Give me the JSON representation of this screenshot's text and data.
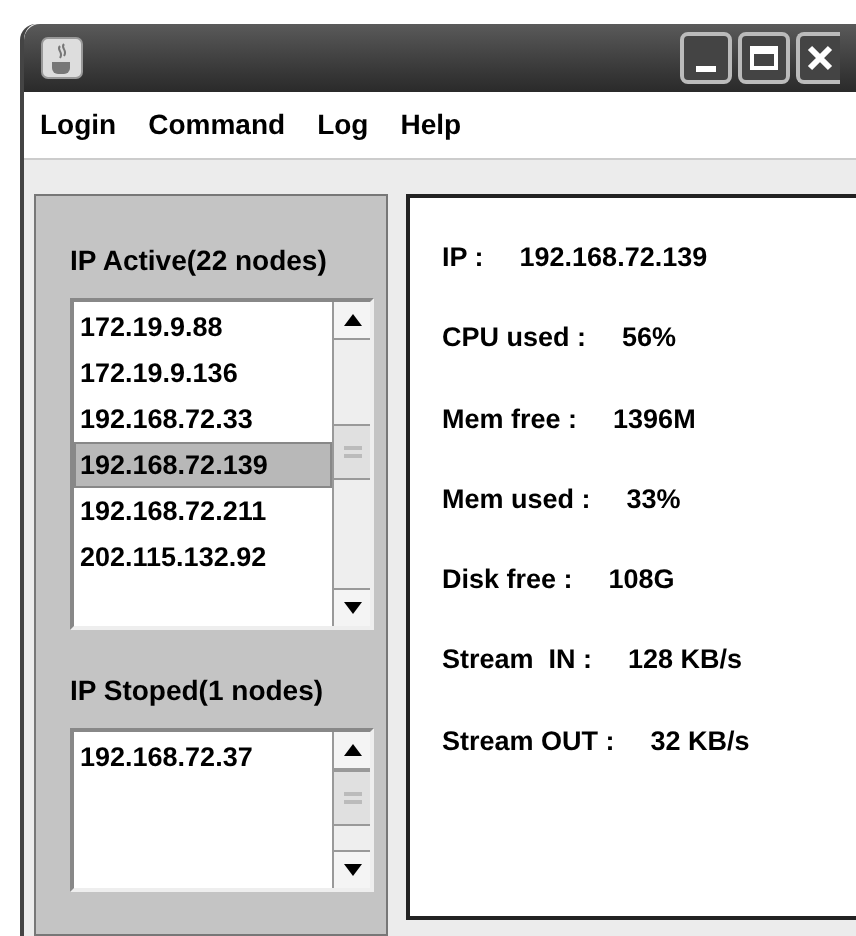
{
  "menu": [
    {
      "label": "Login"
    },
    {
      "label": "Command"
    },
    {
      "label": "Log"
    },
    {
      "label": "Help"
    }
  ],
  "active": {
    "title": "IP Active(22 nodes)",
    "items": [
      {
        "label": "172.19.9.88",
        "selected": false
      },
      {
        "label": "172.19.9.136",
        "selected": false
      },
      {
        "label": "192.168.72.33",
        "selected": false
      },
      {
        "label": "192.168.72.139",
        "selected": true
      },
      {
        "label": "192.168.72.211",
        "selected": false
      },
      {
        "label": "202.115.132.92",
        "selected": false
      }
    ]
  },
  "stopped": {
    "title": "IP Stoped(1 nodes)",
    "items": [
      {
        "label": "192.168.72.37",
        "selected": false
      }
    ]
  },
  "details": [
    {
      "label": "IP :",
      "value": "192.168.72.139"
    },
    {
      "label": "CPU used :",
      "value": "56%"
    },
    {
      "label": "Mem free :",
      "value": "1396M"
    },
    {
      "label": "Mem used :",
      "value": "33%"
    },
    {
      "label": "Disk free :",
      "value": "108G"
    },
    {
      "label": "Stream  IN :",
      "value": "128 KB/s"
    },
    {
      "label": "Stream OUT :",
      "value": "32 KB/s"
    }
  ]
}
